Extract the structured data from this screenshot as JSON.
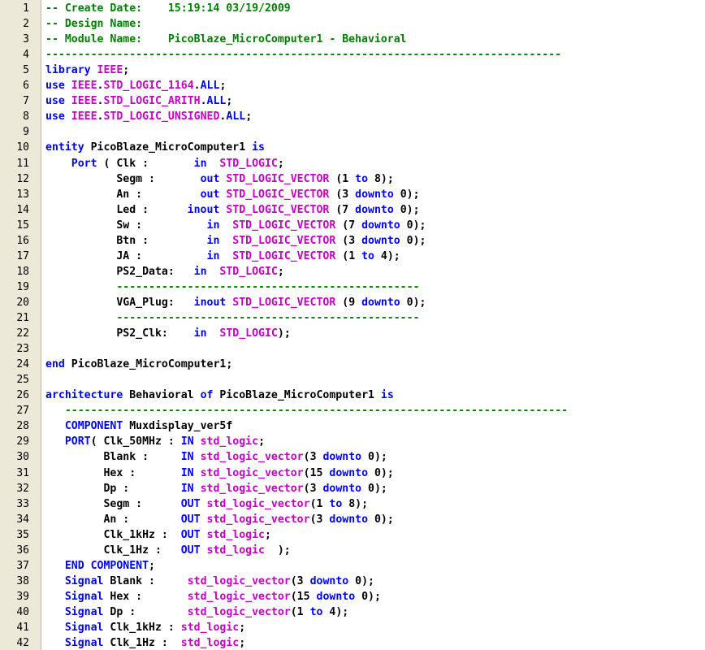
{
  "editor": {
    "colors": {
      "keyword": "#0000ff",
      "type": "#c800c8",
      "comment": "#008000",
      "text": "#000000",
      "gutter": "#ece9d8"
    },
    "lines": [
      {
        "n": "1",
        "t": [
          [
            "c",
            "-- Create Date:    15:19:14 03/19/2009"
          ]
        ]
      },
      {
        "n": "2",
        "t": [
          [
            "c",
            "-- Design Name:"
          ]
        ]
      },
      {
        "n": "3",
        "t": [
          [
            "c",
            "-- Module Name:    PicoBlaze_MicroComputer1 - Behavioral"
          ]
        ]
      },
      {
        "n": "4",
        "t": [
          [
            "c",
            "--------------------------------------------------------------------------------"
          ]
        ]
      },
      {
        "n": "5",
        "t": [
          [
            "k",
            "library"
          ],
          [
            "p",
            " "
          ],
          [
            "t",
            "IEEE"
          ],
          [
            "p",
            ";"
          ]
        ]
      },
      {
        "n": "6",
        "t": [
          [
            "k",
            "use"
          ],
          [
            "p",
            " "
          ],
          [
            "t",
            "IEEE"
          ],
          [
            "p",
            "."
          ],
          [
            "t",
            "STD_LOGIC_1164"
          ],
          [
            "p",
            "."
          ],
          [
            "k",
            "ALL"
          ],
          [
            "p",
            ";"
          ]
        ]
      },
      {
        "n": "7",
        "t": [
          [
            "k",
            "use"
          ],
          [
            "p",
            " "
          ],
          [
            "t",
            "IEEE"
          ],
          [
            "p",
            "."
          ],
          [
            "t",
            "STD_LOGIC_ARITH"
          ],
          [
            "p",
            "."
          ],
          [
            "k",
            "ALL"
          ],
          [
            "p",
            ";"
          ]
        ]
      },
      {
        "n": "8",
        "t": [
          [
            "k",
            "use"
          ],
          [
            "p",
            " "
          ],
          [
            "t",
            "IEEE"
          ],
          [
            "p",
            "."
          ],
          [
            "t",
            "STD_LOGIC_UNSIGNED"
          ],
          [
            "p",
            "."
          ],
          [
            "k",
            "ALL"
          ],
          [
            "p",
            ";"
          ]
        ]
      },
      {
        "n": "9",
        "t": []
      },
      {
        "n": "10",
        "t": [
          [
            "k",
            "entity"
          ],
          [
            "i",
            " PicoBlaze_MicroComputer1 "
          ],
          [
            "k",
            "is"
          ]
        ]
      },
      {
        "n": "11",
        "t": [
          [
            "p",
            "    "
          ],
          [
            "k",
            "Port"
          ],
          [
            "p",
            " ( Clk :       "
          ],
          [
            "k",
            "in"
          ],
          [
            "p",
            "  "
          ],
          [
            "t",
            "STD_LOGIC"
          ],
          [
            "p",
            ";"
          ]
        ]
      },
      {
        "n": "12",
        "t": [
          [
            "p",
            "           Segm :       "
          ],
          [
            "k",
            "out"
          ],
          [
            "p",
            " "
          ],
          [
            "t",
            "STD_LOGIC_VECTOR"
          ],
          [
            "p",
            " (1 "
          ],
          [
            "k",
            "to"
          ],
          [
            "p",
            " 8);"
          ]
        ]
      },
      {
        "n": "13",
        "t": [
          [
            "p",
            "           An :         "
          ],
          [
            "k",
            "out"
          ],
          [
            "p",
            " "
          ],
          [
            "t",
            "STD_LOGIC_VECTOR"
          ],
          [
            "p",
            " (3 "
          ],
          [
            "k",
            "downto"
          ],
          [
            "p",
            " 0);"
          ]
        ]
      },
      {
        "n": "14",
        "t": [
          [
            "p",
            "           Led :      "
          ],
          [
            "k",
            "inout"
          ],
          [
            "p",
            " "
          ],
          [
            "t",
            "STD_LOGIC_VECTOR"
          ],
          [
            "p",
            " (7 "
          ],
          [
            "k",
            "downto"
          ],
          [
            "p",
            " 0);"
          ]
        ]
      },
      {
        "n": "15",
        "t": [
          [
            "p",
            "           Sw :          "
          ],
          [
            "k",
            "in"
          ],
          [
            "p",
            "  "
          ],
          [
            "t",
            "STD_LOGIC_VECTOR"
          ],
          [
            "p",
            " (7 "
          ],
          [
            "k",
            "downto"
          ],
          [
            "p",
            " 0);"
          ]
        ]
      },
      {
        "n": "16",
        "t": [
          [
            "p",
            "           Btn :         "
          ],
          [
            "k",
            "in"
          ],
          [
            "p",
            "  "
          ],
          [
            "t",
            "STD_LOGIC_VECTOR"
          ],
          [
            "p",
            " (3 "
          ],
          [
            "k",
            "downto"
          ],
          [
            "p",
            " 0);"
          ]
        ]
      },
      {
        "n": "17",
        "t": [
          [
            "p",
            "           JA :          "
          ],
          [
            "k",
            "in"
          ],
          [
            "p",
            "  "
          ],
          [
            "t",
            "STD_LOGIC_VECTOR"
          ],
          [
            "p",
            " (1 "
          ],
          [
            "k",
            "to"
          ],
          [
            "p",
            " 4);"
          ]
        ]
      },
      {
        "n": "18",
        "t": [
          [
            "p",
            "           PS2_Data:   "
          ],
          [
            "k",
            "in"
          ],
          [
            "p",
            "  "
          ],
          [
            "t",
            "STD_LOGIC"
          ],
          [
            "p",
            ";"
          ]
        ]
      },
      {
        "n": "19",
        "t": [
          [
            "p",
            "           "
          ],
          [
            "c",
            "-----------------------------------------------"
          ]
        ]
      },
      {
        "n": "20",
        "t": [
          [
            "p",
            "           VGA_Plug:   "
          ],
          [
            "k",
            "inout"
          ],
          [
            "p",
            " "
          ],
          [
            "t",
            "STD_LOGIC_VECTOR"
          ],
          [
            "p",
            " (9 "
          ],
          [
            "k",
            "downto"
          ],
          [
            "p",
            " 0);"
          ]
        ]
      },
      {
        "n": "21",
        "t": [
          [
            "p",
            "           "
          ],
          [
            "c",
            "-----------------------------------------------"
          ]
        ]
      },
      {
        "n": "22",
        "t": [
          [
            "p",
            "           PS2_Clk:    "
          ],
          [
            "k",
            "in"
          ],
          [
            "p",
            "  "
          ],
          [
            "t",
            "STD_LOGIC"
          ],
          [
            "p",
            ");"
          ]
        ]
      },
      {
        "n": "23",
        "t": []
      },
      {
        "n": "24",
        "t": [
          [
            "k",
            "end"
          ],
          [
            "i",
            " PicoBlaze_MicroComputer1;"
          ]
        ]
      },
      {
        "n": "25",
        "t": []
      },
      {
        "n": "26",
        "t": [
          [
            "k",
            "architecture"
          ],
          [
            "i",
            " Behavioral "
          ],
          [
            "k",
            "of"
          ],
          [
            "i",
            " PicoBlaze_MicroComputer1 "
          ],
          [
            "k",
            "is"
          ]
        ]
      },
      {
        "n": "27",
        "t": [
          [
            "p",
            "   "
          ],
          [
            "c",
            "------------------------------------------------------------------------------"
          ]
        ]
      },
      {
        "n": "28",
        "t": [
          [
            "p",
            "   "
          ],
          [
            "k",
            "COMPONENT"
          ],
          [
            "i",
            " Muxdisplay_ver5f"
          ]
        ]
      },
      {
        "n": "29",
        "t": [
          [
            "p",
            "   "
          ],
          [
            "k",
            "PORT"
          ],
          [
            "p",
            "( Clk_50MHz : "
          ],
          [
            "k",
            "IN"
          ],
          [
            "p",
            " "
          ],
          [
            "t",
            "std_logic"
          ],
          [
            "p",
            ";"
          ]
        ]
      },
      {
        "n": "30",
        "t": [
          [
            "p",
            "         Blank :     "
          ],
          [
            "k",
            "IN"
          ],
          [
            "p",
            " "
          ],
          [
            "t",
            "std_logic_vector"
          ],
          [
            "p",
            "(3 "
          ],
          [
            "k",
            "downto"
          ],
          [
            "p",
            " 0);"
          ]
        ]
      },
      {
        "n": "31",
        "t": [
          [
            "p",
            "         Hex :       "
          ],
          [
            "k",
            "IN"
          ],
          [
            "p",
            " "
          ],
          [
            "t",
            "std_logic_vector"
          ],
          [
            "p",
            "(15 "
          ],
          [
            "k",
            "downto"
          ],
          [
            "p",
            " 0);"
          ]
        ]
      },
      {
        "n": "32",
        "t": [
          [
            "p",
            "         Dp :        "
          ],
          [
            "k",
            "IN"
          ],
          [
            "p",
            " "
          ],
          [
            "t",
            "std_logic_vector"
          ],
          [
            "p",
            "(3 "
          ],
          [
            "k",
            "downto"
          ],
          [
            "p",
            " 0);"
          ]
        ]
      },
      {
        "n": "33",
        "t": [
          [
            "p",
            "         Segm :      "
          ],
          [
            "k",
            "OUT"
          ],
          [
            "p",
            " "
          ],
          [
            "t",
            "std_logic_vector"
          ],
          [
            "p",
            "(1 "
          ],
          [
            "k",
            "to"
          ],
          [
            "p",
            " 8);"
          ]
        ]
      },
      {
        "n": "34",
        "t": [
          [
            "p",
            "         An :        "
          ],
          [
            "k",
            "OUT"
          ],
          [
            "p",
            " "
          ],
          [
            "t",
            "std_logic_vector"
          ],
          [
            "p",
            "(3 "
          ],
          [
            "k",
            "downto"
          ],
          [
            "p",
            " 0);"
          ]
        ]
      },
      {
        "n": "35",
        "t": [
          [
            "p",
            "         Clk_1kHz :  "
          ],
          [
            "k",
            "OUT"
          ],
          [
            "p",
            " "
          ],
          [
            "t",
            "std_logic"
          ],
          [
            "p",
            ";"
          ]
        ]
      },
      {
        "n": "36",
        "t": [
          [
            "p",
            "         Clk_1Hz :   "
          ],
          [
            "k",
            "OUT"
          ],
          [
            "p",
            " "
          ],
          [
            "t",
            "std_logic"
          ],
          [
            "p",
            "  );"
          ]
        ]
      },
      {
        "n": "37",
        "t": [
          [
            "p",
            "   "
          ],
          [
            "k",
            "END COMPONENT"
          ],
          [
            "p",
            ";"
          ]
        ]
      },
      {
        "n": "38",
        "t": [
          [
            "p",
            "   "
          ],
          [
            "k",
            "Signal"
          ],
          [
            "p",
            " Blank :     "
          ],
          [
            "t",
            "std_logic_vector"
          ],
          [
            "p",
            "(3 "
          ],
          [
            "k",
            "downto"
          ],
          [
            "p",
            " 0);"
          ]
        ]
      },
      {
        "n": "39",
        "t": [
          [
            "p",
            "   "
          ],
          [
            "k",
            "Signal"
          ],
          [
            "p",
            " Hex :       "
          ],
          [
            "t",
            "std_logic_vector"
          ],
          [
            "p",
            "(15 "
          ],
          [
            "k",
            "downto"
          ],
          [
            "p",
            " 0);"
          ]
        ]
      },
      {
        "n": "40",
        "t": [
          [
            "p",
            "   "
          ],
          [
            "k",
            "Signal"
          ],
          [
            "p",
            " Dp :        "
          ],
          [
            "t",
            "std_logic_vector"
          ],
          [
            "p",
            "(1 "
          ],
          [
            "k",
            "to"
          ],
          [
            "p",
            " 4);"
          ]
        ]
      },
      {
        "n": "41",
        "t": [
          [
            "p",
            "   "
          ],
          [
            "k",
            "Signal"
          ],
          [
            "p",
            " Clk_1kHz : "
          ],
          [
            "t",
            "std_logic"
          ],
          [
            "p",
            ";"
          ]
        ]
      },
      {
        "n": "42",
        "t": [
          [
            "p",
            "   "
          ],
          [
            "k",
            "Signal"
          ],
          [
            "p",
            " Clk_1Hz :  "
          ],
          [
            "t",
            "std_logic"
          ],
          [
            "p",
            ";"
          ]
        ]
      }
    ]
  }
}
